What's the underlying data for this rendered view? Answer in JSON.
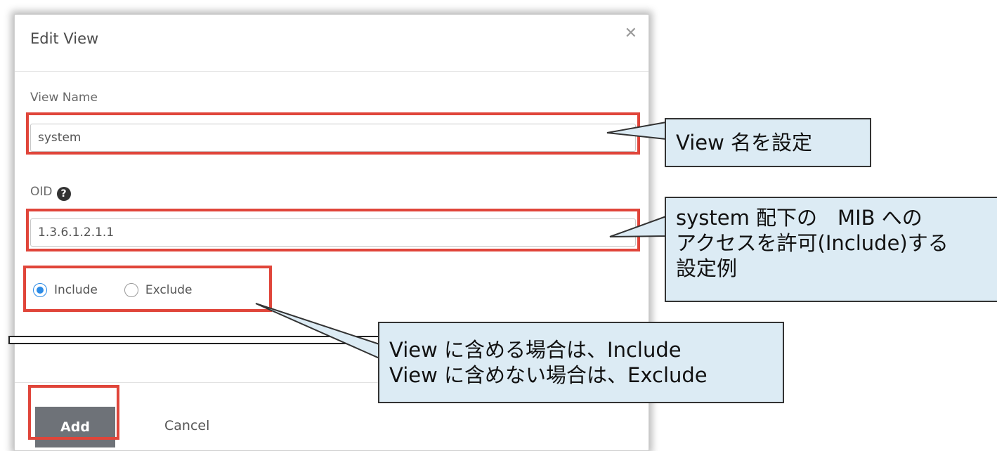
{
  "dialog": {
    "title": "Edit View",
    "close_icon": "close-icon"
  },
  "fields": {
    "view_name": {
      "label": "View Name",
      "value": "system"
    },
    "oid": {
      "label": "OID",
      "help_icon": "question-circle-icon",
      "value": "1.3.6.1.2.1.1"
    }
  },
  "radio": {
    "include_label": "Include",
    "exclude_label": "Exclude",
    "selected": "Include"
  },
  "buttons": {
    "add": "Add",
    "cancel": "Cancel"
  },
  "annotations": {
    "view_name_note": "View 名を設定",
    "oid_note_line1": "system 配下の　MIB への",
    "oid_note_line2": "アクセスを許可(Include)する",
    "oid_note_line3": "設定例",
    "radio_note_line1": "View に含める場合は、Include",
    "radio_note_line2": "View に含めない場合は、Exclude"
  },
  "colors": {
    "highlight": "#e0453a",
    "callout_bg": "#dcebf4",
    "radio_accent": "#2c8be6",
    "add_button_bg": "#6e7278"
  }
}
